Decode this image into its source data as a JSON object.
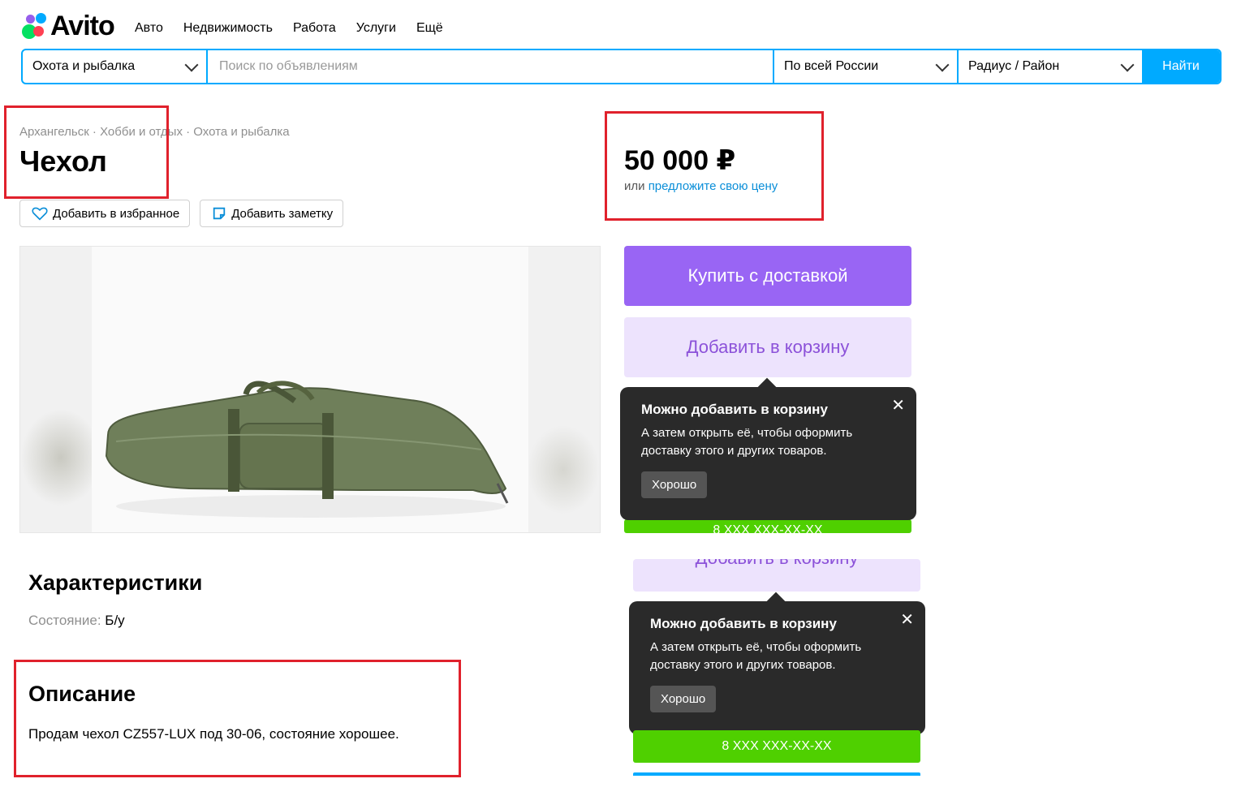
{
  "header": {
    "logo_text": "Avito",
    "nav": [
      "Авто",
      "Недвижимость",
      "Работа",
      "Услуги",
      "Ещё"
    ]
  },
  "search": {
    "category": "Охота и рыбалка",
    "placeholder": "Поиск по объявлениям",
    "region": "По всей России",
    "radius": "Радиус / Район",
    "button": "Найти"
  },
  "listing": {
    "breadcrumbs": "Архангельск · Хобби и отдых · Охота и рыбалка",
    "title": "Чехол",
    "favorite_btn": "Добавить в избранное",
    "note_btn": "Добавить заметку",
    "price": "50 000 ₽",
    "price_or": "или",
    "price_offer_link": "предложите свою цену"
  },
  "actions": {
    "buy_delivery": "Купить с доставкой",
    "add_to_cart": "Добавить в корзину",
    "phone": "8 XXX XXX-XX-XX"
  },
  "tooltip": {
    "title": "Можно добавить в корзину",
    "text": "А затем открыть её, чтобы оформить доставку этого и других товаров.",
    "ok": "Хорошо",
    "close": "✕"
  },
  "characteristics": {
    "heading": "Характеристики",
    "condition_label": "Состояние:",
    "condition_value": "Б/у"
  },
  "description": {
    "heading": "Описание",
    "text": "Продам чехол CZ557-LUX под 30-06, состояние хорошее."
  },
  "colors": {
    "accent_blue": "#00aaff",
    "buy_purple": "#9965f4",
    "cart_bg": "#ede3fd",
    "phone_green": "#4fd000",
    "annotation_red": "#e0212c"
  }
}
